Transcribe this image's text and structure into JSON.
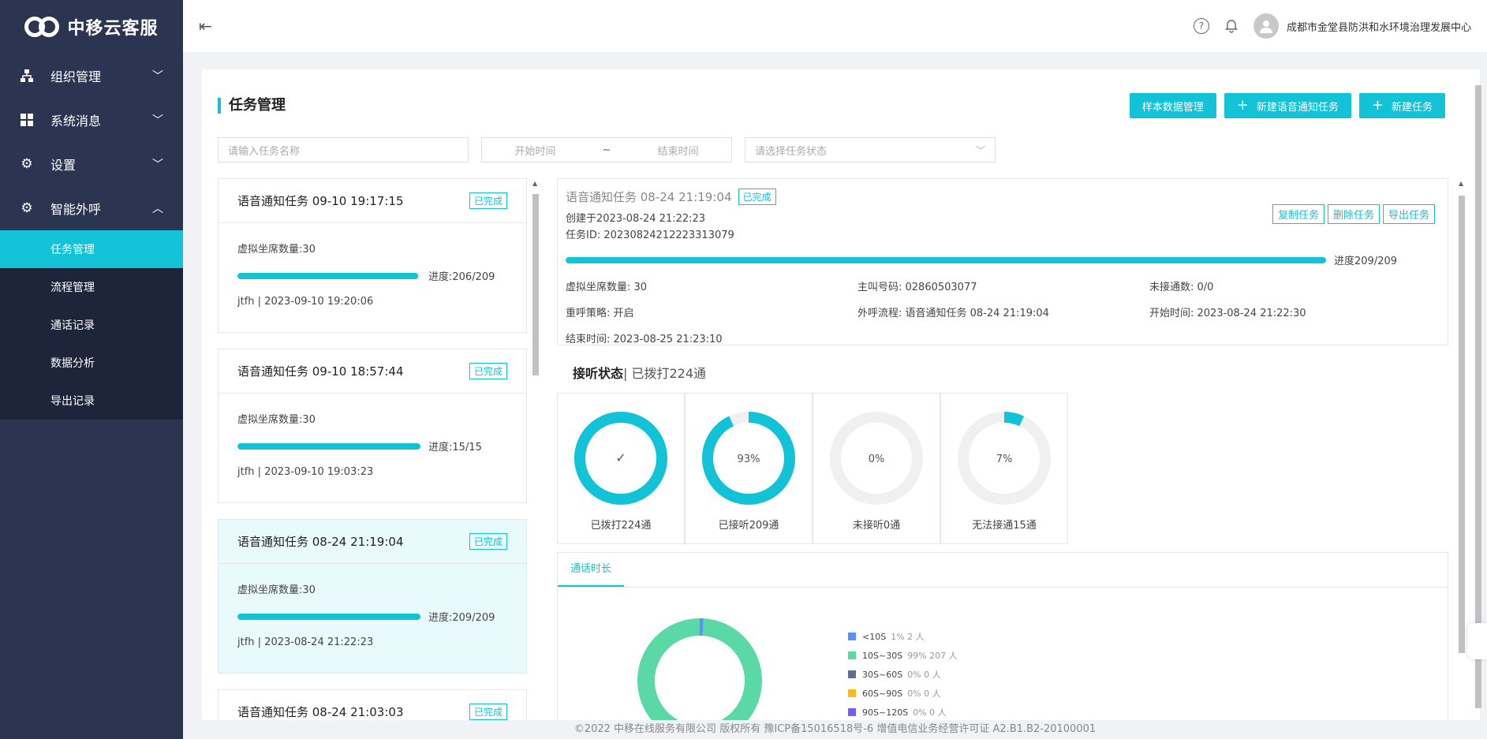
{
  "brand": {
    "logo_text": "中移云客服",
    "logo_sub": "link"
  },
  "sidebar": {
    "groups": [
      {
        "label": "组织管理",
        "icon": "org-chart-icon"
      },
      {
        "label": "系统消息",
        "icon": "dashboard-icon"
      },
      {
        "label": "设置",
        "icon": "gear-icon"
      },
      {
        "label": "智能外呼",
        "icon": "gear-icon"
      }
    ],
    "sub_items": [
      "任务管理",
      "流程管理",
      "通话记录",
      "数据分析",
      "导出记录"
    ]
  },
  "header": {
    "org_name": "成都市金堂县防洪和水环境治理发展中心"
  },
  "page": {
    "title": "任务管理",
    "buttons": {
      "sample": "样本数据管理",
      "new_voice": "新建语音通知任务",
      "new_task": "新建任务"
    },
    "filters": {
      "name_placeholder": "请输入任务名称",
      "start": "开始时间",
      "sep": "~",
      "end": "结束时间",
      "status_placeholder": "请选择任务状态"
    }
  },
  "tasks": [
    {
      "title": "语音通知任务 09-10 19:17:15",
      "status": "已完成",
      "seats": "虚拟坐席数量:30",
      "progress_text": "进度:206/209",
      "progress": 0.986,
      "meta": "jtfh | 2023-09-10 19:20:06"
    },
    {
      "title": "语音通知任务 09-10 18:57:44",
      "status": "已完成",
      "seats": "虚拟坐席数量:30",
      "progress_text": "进度:15/15",
      "progress": 1.0,
      "meta": "jtfh | 2023-09-10 19:03:23"
    },
    {
      "title": "语音通知任务 08-24 21:19:04",
      "status": "已完成",
      "seats": "虚拟坐席数量:30",
      "progress_text": "进度:209/209",
      "progress": 1.0,
      "meta": "jtfh | 2023-08-24 21:22:23"
    },
    {
      "title": "语音通知任务 08-24 21:03:03",
      "status": "已完成",
      "seats": "",
      "progress_text": "",
      "progress": 1.0,
      "meta": ""
    }
  ],
  "detail": {
    "title": "语音通知任务 08-24 21:19:04",
    "status": "已完成",
    "created": "创建于2023-08-24 21:22:23",
    "task_id": "任务ID: 20230824212223313079",
    "actions": {
      "copy": "复制任务",
      "delete": "删除任务",
      "export": "导出任务"
    },
    "progress_text": "进度209/209",
    "progress": 1.0,
    "info": [
      "虚拟坐席数量: 30",
      "主叫号码: 02860503077",
      "未接通数: 0/0",
      "重呼策略: 开启",
      "外呼流程: 语音通知任务 08-24 21:19:04",
      "开始时间: 2023-08-24 21:22:30",
      "结束时间: 2023-08-25 21:23:10"
    ],
    "answer_title": "接听状态",
    "answer_sub": "| 已拨打224通",
    "donuts": [
      {
        "center": "✓",
        "label": "已拨打224通",
        "value": 1.0
      },
      {
        "center": "93%",
        "label": "已接听209通",
        "value": 0.93
      },
      {
        "center": "0%",
        "label": "未接听0通",
        "value": 0.0
      },
      {
        "center": "7%",
        "label": "无法接通15通",
        "value": 0.07
      }
    ],
    "duration_tab": "通话时长",
    "legend": [
      {
        "range": "<10S",
        "pct": "1% 2 人",
        "color": "#5b8ff9",
        "value": 0.01
      },
      {
        "range": "10S~30S",
        "pct": "99% 207 人",
        "color": "#5ad8a6",
        "value": 0.99
      },
      {
        "range": "30S~60S",
        "pct": "0% 0 人",
        "color": "#5d7092",
        "value": 0
      },
      {
        "range": "60S~90S",
        "pct": "0% 0 人",
        "color": "#f6bd16",
        "value": 0
      },
      {
        "range": "90S~120S",
        "pct": "0% 0 人",
        "color": "#6f5ef9",
        "value": 0
      }
    ]
  },
  "footer": "©2022 中移在线服务有限公司 版权所有 豫ICP备15016518号-6 增值电信业务经营许可证 A2.B1.B2-20100001",
  "colors": {
    "accent": "#12c3d7",
    "sidebar": "#2b3450",
    "submenu": "#1e243a"
  }
}
